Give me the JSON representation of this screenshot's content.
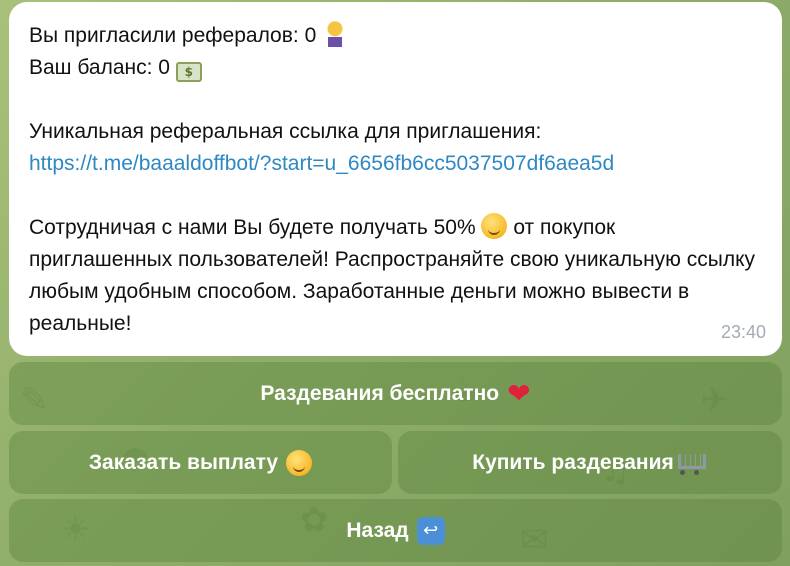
{
  "message": {
    "line1": "Вы пригласили рефералов: 0",
    "line1_emoji": "person-with-dollar-icon",
    "line2": "Ваш баланс: 0",
    "line2_emoji": "money-bill-icon",
    "line3": "Уникальная реферальная ссылка для приглашения:",
    "link": "https://t.me/baaaldoffbot/?start=u_6656fb6cc5037507df6aea5d",
    "para_part1": "Сотрудничая с нами Вы будете получать 50%",
    "para_emoji": "smirking-face-icon",
    "para_part2": "от покупок приглашенных пользователей! Распространяйте свою уникальную ссылку любым удобным способом. Заработанные деньги можно вывести в реальные!",
    "time": "23:40"
  },
  "keyboard": {
    "row1": {
      "label": "Раздевания бесплатно",
      "icon": "heart-icon"
    },
    "row2_left": {
      "label": "Заказать выплату",
      "icon": "smiling-face-icon"
    },
    "row2_right": {
      "label": "Купить раздевания",
      "icon": "shopping-cart-icon"
    },
    "row3": {
      "label": "Назад",
      "icon": "return-arrow-icon"
    }
  },
  "colors": {
    "link": "#2e88c4",
    "time": "#a2acb4",
    "heart": "#e0213a",
    "button_bg": "rgba(90,130,60,0.42)",
    "wallpaper": "#8fae6a"
  }
}
